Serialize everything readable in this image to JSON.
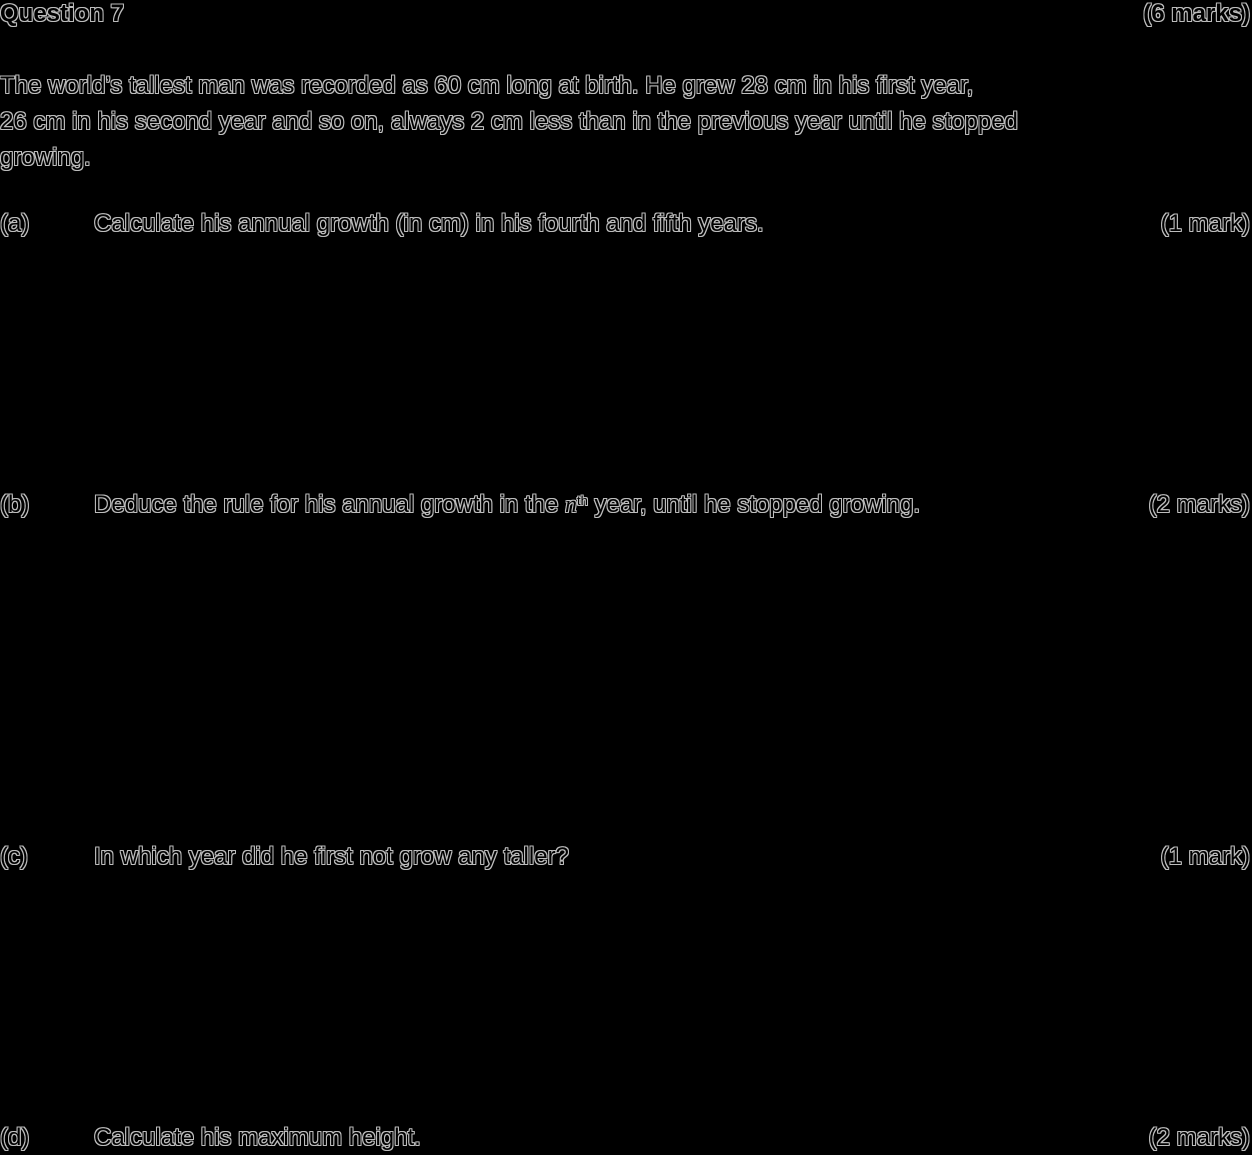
{
  "question": {
    "title": "Question 7",
    "total_marks": "(6 marks)",
    "stem_lines": [
      "The world’s tallest man was recorded as 60 cm long at birth. He grew 28 cm in his first year,",
      "26 cm in his second year and so on, always 2 cm less than in the previous year until he stopped",
      "growing."
    ]
  },
  "parts": {
    "a": {
      "label": "(a)",
      "text": "Calculate his annual growth (in cm) in his fourth and fifth years.",
      "marks": "(1 mark)"
    },
    "b": {
      "label": "(b)",
      "text_before": "Deduce the rule for his annual growth in the ",
      "n_symbol": "n",
      "superscript": "th",
      "text_after": " year, until he stopped growing.",
      "marks": "(2 marks)"
    },
    "c": {
      "label": "(c)",
      "text": "In which year did he first not grow any taller?",
      "marks": "(1 mark)"
    },
    "d": {
      "label": "(d)",
      "text": "Calculate his maximum height.",
      "marks": "(2 marks)"
    }
  }
}
